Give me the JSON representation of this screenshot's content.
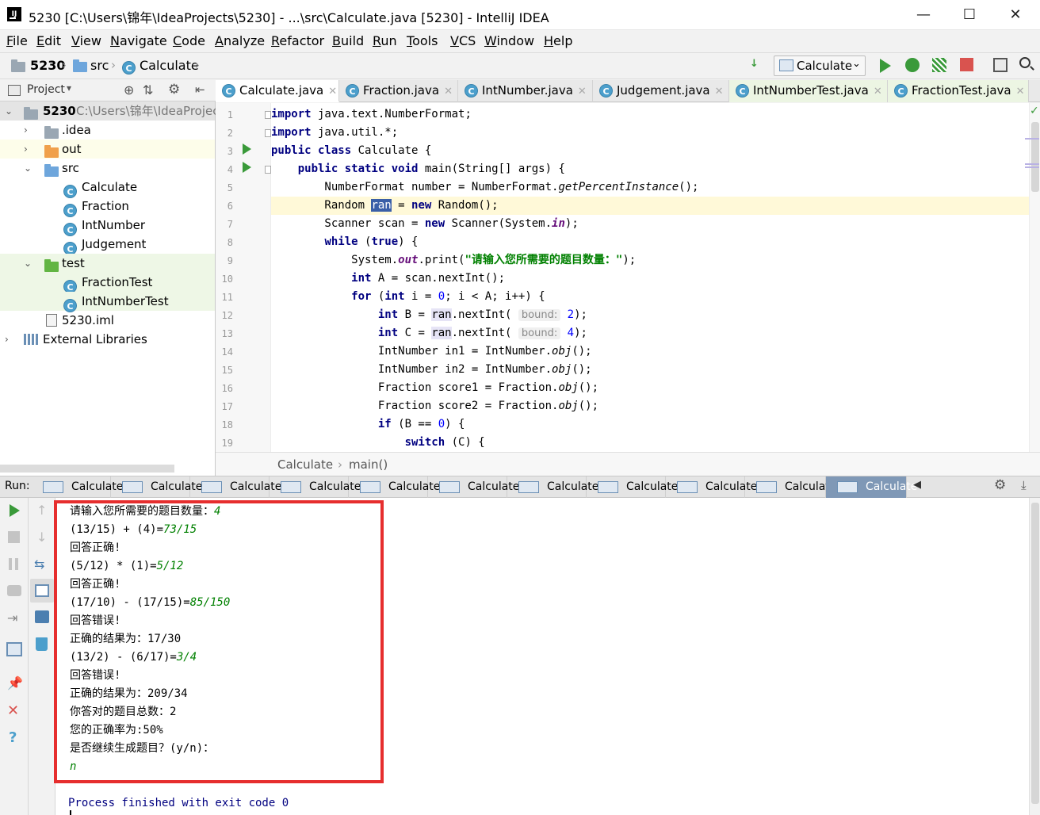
{
  "window": {
    "title": "5230 [C:\\Users\\锦年\\IdeaProjects\\5230] - ...\\src\\Calculate.java [5230] - IntelliJ IDEA",
    "minimize": "—",
    "maximize": "☐",
    "close": "✕"
  },
  "menu": [
    "File",
    "Edit",
    "View",
    "Navigate",
    "Code",
    "Analyze",
    "Refactor",
    "Build",
    "Run",
    "Tools",
    "VCS",
    "Window",
    "Help"
  ],
  "navbar": {
    "crumbs": [
      "5230",
      "src",
      "Calculate"
    ],
    "run_config": "Calculate"
  },
  "project": {
    "header_label": "Project",
    "tree": [
      {
        "label": "5230",
        "extra": "C:\\Users\\锦年\\IdeaProjec"
      },
      {
        "label": ".idea"
      },
      {
        "label": "out"
      },
      {
        "label": "src"
      },
      {
        "label": "Calculate"
      },
      {
        "label": "Fraction"
      },
      {
        "label": "IntNumber"
      },
      {
        "label": "Judgement"
      },
      {
        "label": "test"
      },
      {
        "label": "FractionTest"
      },
      {
        "label": "IntNumberTest"
      },
      {
        "label": "5230.iml"
      },
      {
        "label": "External Libraries"
      }
    ]
  },
  "editor": {
    "tabs": [
      "Calculate.java",
      "Fraction.java",
      "IntNumber.java",
      "Judgement.java",
      "IntNumberTest.java",
      "FractionTest.java"
    ],
    "line_numbers": [
      "1",
      "2",
      "3",
      "4",
      "5",
      "6",
      "7",
      "8",
      "9",
      "10",
      "11",
      "12",
      "13",
      "14",
      "15",
      "16",
      "17",
      "18",
      "19"
    ],
    "breadcrumb": [
      "Calculate",
      "main()"
    ]
  },
  "run": {
    "label": "Run:",
    "tabs": [
      "Calculate",
      "Calculate",
      "Calculate",
      "Calculate",
      "Calculate",
      "Calculate",
      "Calculate",
      "Calculate",
      "Calculate",
      "Calculate",
      "Calculate"
    ],
    "console": [
      {
        "text": "请输入您所需要的题目数量：",
        "input": "4"
      },
      {
        "text": "(13/15) + (4)=",
        "input": "73/15"
      },
      {
        "text": "回答正确!",
        "input": ""
      },
      {
        "text": "(5/12) * (1)=",
        "input": "5/12"
      },
      {
        "text": "回答正确!",
        "input": ""
      },
      {
        "text": "(17/10) - (17/15)=",
        "input": "85/150"
      },
      {
        "text": "回答错误!",
        "input": ""
      },
      {
        "text": "正确的结果为：17/30",
        "input": ""
      },
      {
        "text": "(13/2) - (6/17)=",
        "input": "3/4"
      },
      {
        "text": "回答错误!",
        "input": ""
      },
      {
        "text": "正确的结果为：209/34",
        "input": ""
      },
      {
        "text": "你答对的题目总数：2",
        "input": ""
      },
      {
        "text": "您的正确率为:50%",
        "input": ""
      },
      {
        "text": "是否继续生成题目？(y/n)：",
        "input": ""
      },
      {
        "text": "",
        "input": "n"
      }
    ],
    "exit_message": "Process finished with exit code 0"
  },
  "colors": {
    "accent_red": "#e62e2e",
    "run_green": "#3a9a3a",
    "keyword": "#000080",
    "string": "#008000"
  }
}
